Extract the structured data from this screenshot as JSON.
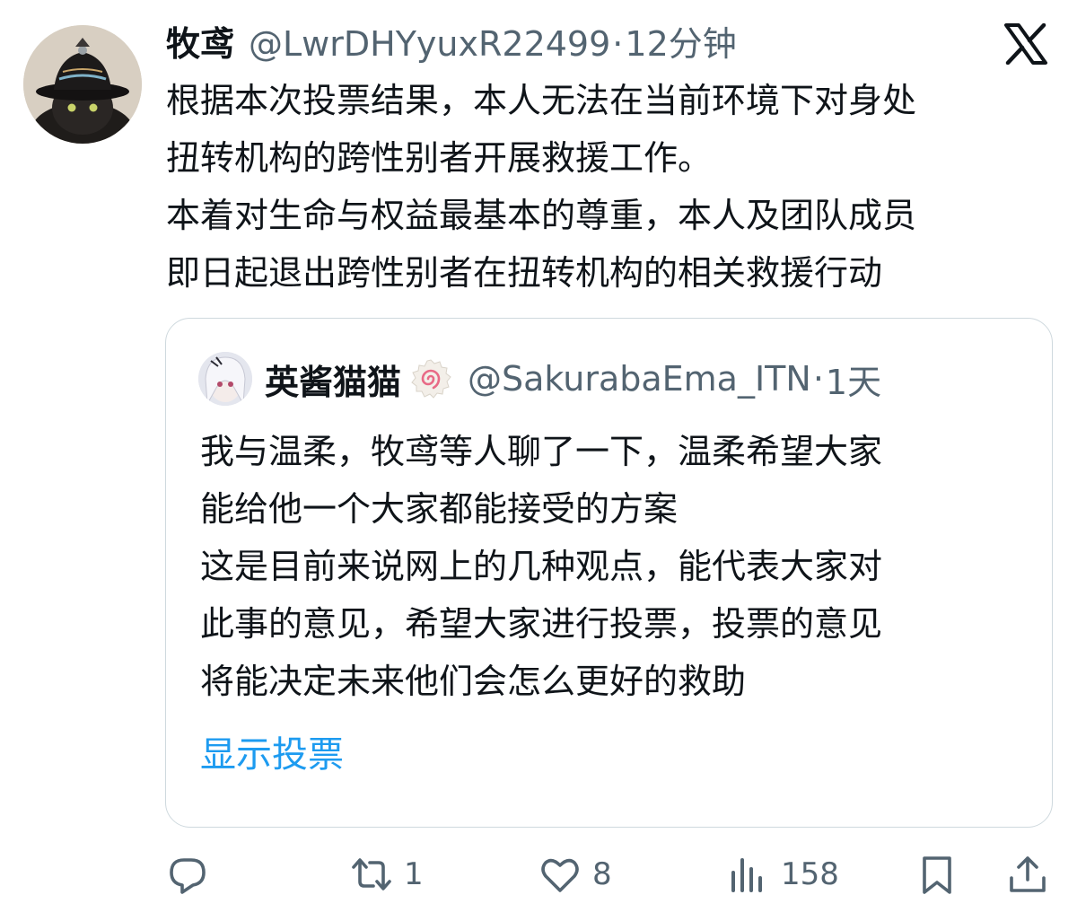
{
  "tweet": {
    "author_name": "牧鸢",
    "author_handle": "@LwrDHYyuxR22499",
    "separator": "·",
    "time": "12分钟",
    "text_lines": [
      "根据本次投票结果，本人无法在当前环境下对身处",
      "扭转机构的跨性别者开展救援工作。",
      "本着对生命与权益最基本的尊重，本人及团队成员",
      "即日起退出跨性别者在扭转机构的相关救援行动"
    ]
  },
  "quote": {
    "author_name": "英酱猫猫",
    "author_handle": "@SakurabaEma_ITN",
    "separator": "·",
    "time": "1天",
    "text_lines": [
      "我与温柔，牧鸢等人聊了一下，温柔希望大家",
      "能给他一个大家都能接受的方案",
      "这是目前来说网上的几种观点，能代表大家对",
      "此事的意见，希望大家进行投票，投票的意见",
      "将能决定未来他们会怎么更好的救助"
    ],
    "show_poll_label": "显示投票"
  },
  "actions": {
    "reply_icon": "reply-icon",
    "retweet_count": "1",
    "like_count": "8",
    "views_count": "158",
    "bookmark_icon": "bookmark-icon",
    "share_icon": "share-icon"
  },
  "colors": {
    "text": "#0f1419",
    "secondary": "#536471",
    "link": "#1d9bf0",
    "border": "#cfd9de"
  }
}
